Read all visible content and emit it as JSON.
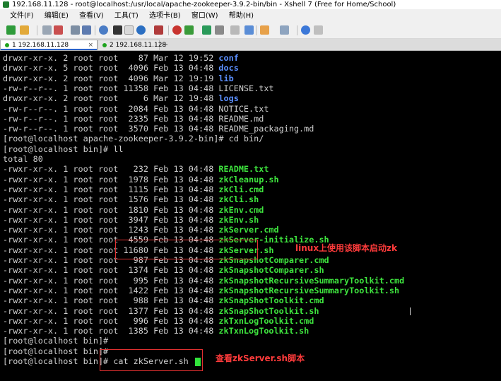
{
  "window": {
    "title": "192.168.11.128 - root@localhost:/usr/local/apache-zookeeper-3.9.2-bin/bin - Xshell 7 (Free for Home/School)"
  },
  "menu": [
    "文件(F)",
    "编辑(E)",
    "查看(V)",
    "工具(T)",
    "选项卡(B)",
    "窗口(W)",
    "帮助(H)"
  ],
  "tabs": [
    {
      "label": "1 192.168.11.128",
      "active": true
    },
    {
      "label": "2 192.168.11.128",
      "active": false
    }
  ],
  "terminal": {
    "lines": [
      {
        "perm": "drwxr-xr-x. 2 root root    87 Mar 12 19:52 ",
        "name": "conf",
        "kind": "dir"
      },
      {
        "perm": "drwxr-xr-x. 5 root root  4096 Feb 13 04:48 ",
        "name": "docs",
        "kind": "dir"
      },
      {
        "perm": "drwxr-xr-x. 2 root root  4096 Mar 12 19:19 ",
        "name": "lib",
        "kind": "dir"
      },
      {
        "perm": "-rw-r--r--. 1 root root 11358 Feb 13 04:48 ",
        "name": "LICENSE.txt",
        "kind": "file"
      },
      {
        "perm": "drwxr-xr-x. 2 root root     6 Mar 12 19:48 ",
        "name": "logs",
        "kind": "dir"
      },
      {
        "perm": "-rw-r--r--. 1 root root  2084 Feb 13 04:48 ",
        "name": "NOTICE.txt",
        "kind": "file"
      },
      {
        "perm": "-rw-r--r--. 1 root root  2335 Feb 13 04:48 ",
        "name": "README.md",
        "kind": "file"
      },
      {
        "perm": "-rw-r--r--. 1 root root  3570 Feb 13 04:48 ",
        "name": "README_packaging.md",
        "kind": "file"
      },
      {
        "perm": "[root@localhost apache-zookeeper-3.9.2-bin]# cd bin/",
        "name": "",
        "kind": "file"
      },
      {
        "perm": "[root@localhost bin]# ll",
        "name": "",
        "kind": "file"
      },
      {
        "perm": "total 80",
        "name": "",
        "kind": "file"
      },
      {
        "perm": "-rwxr-xr-x. 1 root root   232 Feb 13 04:48 ",
        "name": "README.txt",
        "kind": "exe"
      },
      {
        "perm": "-rwxr-xr-x. 1 root root  1978 Feb 13 04:48 ",
        "name": "zkCleanup.sh",
        "kind": "exe"
      },
      {
        "perm": "-rwxr-xr-x. 1 root root  1115 Feb 13 04:48 ",
        "name": "zkCli.cmd",
        "kind": "exe"
      },
      {
        "perm": "-rwxr-xr-x. 1 root root  1576 Feb 13 04:48 ",
        "name": "zkCli.sh",
        "kind": "exe"
      },
      {
        "perm": "-rwxr-xr-x. 1 root root  1810 Feb 13 04:48 ",
        "name": "zkEnv.cmd",
        "kind": "exe"
      },
      {
        "perm": "-rwxr-xr-x. 1 root root  3947 Feb 13 04:48 ",
        "name": "zkEnv.sh",
        "kind": "exe"
      },
      {
        "perm": "-rwxr-xr-x. 1 root root  1243 Feb 13 04:48 ",
        "name": "zkServer.cmd",
        "kind": "exe"
      },
      {
        "perm": "-rwxr-xr-x. 1 root root  4559 Feb 13 04:48 ",
        "name": "zkServer-initialize.sh",
        "kind": "exe"
      },
      {
        "perm": "-rwxr-xr-x. 1 root root 11680 Feb 13 04:48 ",
        "name": "zkServer.sh",
        "kind": "exe"
      },
      {
        "perm": "-rwxr-xr-x. 1 root root   987 Feb 13 04:48 ",
        "name": "zkSnapshotComparer.cmd",
        "kind": "exe"
      },
      {
        "perm": "-rwxr-xr-x. 1 root root  1374 Feb 13 04:48 ",
        "name": "zkSnapshotComparer.sh",
        "kind": "exe"
      },
      {
        "perm": "-rwxr-xr-x. 1 root root   995 Feb 13 04:48 ",
        "name": "zkSnapshotRecursiveSummaryToolkit.cmd",
        "kind": "exe"
      },
      {
        "perm": "-rwxr-xr-x. 1 root root  1422 Feb 13 04:48 ",
        "name": "zkSnapshotRecursiveSummaryToolkit.sh",
        "kind": "exe"
      },
      {
        "perm": "-rwxr-xr-x. 1 root root   988 Feb 13 04:48 ",
        "name": "zkSnapShotToolkit.cmd",
        "kind": "exe"
      },
      {
        "perm": "-rwxr-xr-x. 1 root root  1377 Feb 13 04:48 ",
        "name": "zkSnapShotToolkit.sh",
        "kind": "exe"
      },
      {
        "perm": "-rwxr-xr-x. 1 root root   996 Feb 13 04:48 ",
        "name": "zkTxnLogToolkit.cmd",
        "kind": "exe"
      },
      {
        "perm": "-rwxr-xr-x. 1 root root  1385 Feb 13 04:48 ",
        "name": "zkTxnLogToolkit.sh",
        "kind": "exe"
      },
      {
        "perm": "[root@localhost bin]#",
        "name": "",
        "kind": "file"
      },
      {
        "perm": "[root@localhost bin]#",
        "name": "",
        "kind": "file"
      },
      {
        "perm": "[root@localhost bin]# cat zkServer.sh ",
        "name": "",
        "kind": "file"
      }
    ]
  },
  "annotations": {
    "start_script": "linux上使用该脚本启动zk",
    "view_script": "查看zkServer.sh脚本"
  },
  "colors": {
    "dir": "#5b8fff",
    "exe": "#3ee43e",
    "annotation": "#ff3b3b",
    "cursor": "#31e33b"
  }
}
